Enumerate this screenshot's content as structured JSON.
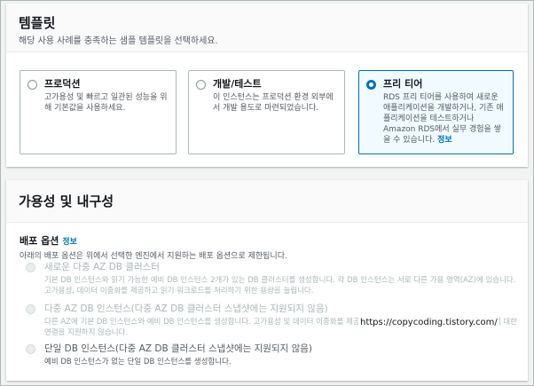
{
  "templates": {
    "title": "템플릿",
    "description": "해당 사용 사례를 충족하는 샘플 템플릿을 선택하세요.",
    "options": [
      {
        "title": "프로덕션",
        "text": "고가용성 및 빠르고 일관된 성능을 위해 기본값을 사용하세요.",
        "selected": false
      },
      {
        "title": "개발/테스트",
        "text": "이 인스턴스는 프로덕션 환경 외부에서 개발 용도로 마련되었습니다.",
        "selected": false
      },
      {
        "title": "프리 티어",
        "text": "RDS 프리 티어를 사용하여 새로운 애플리케이션을 개발하거나, 기존 애플리케이션을 테스트하거나 Amazon RDS에서 실무 경험을 쌓을 수 있습니다.",
        "link": "정보",
        "selected": true
      }
    ]
  },
  "availability": {
    "title": "가용성 및 내구성",
    "deploy_label": "배포 옵션",
    "deploy_info": "정보",
    "deploy_desc": "아래의 배포 옵션은 위에서 선택한 엔진에서 지원하는 배포 옵션으로 제한됩니다.",
    "options": [
      {
        "title": "새로운 다중 AZ DB 클러스터",
        "text": "기본 DB 인스턴스와 읽기 가능한 예비 DB 인스턴스 2개가 있는 DB 클러스터를 생성합니다. 각 DB 인스턴스는 서로 다른 가용 영역(AZ)에 있습니다. 고가용성, 데이터 이중화를 제공하고 읽기 워크로드를 처리하기 위한 용량을 늘립니다.",
        "enabled": false
      },
      {
        "title": "다중 AZ DB 인스턴스(다중 AZ DB 클러스터 스냅샷에는 지원되지 않음)",
        "text": "다른 AZ에 기본 DB 인스턴스와 예비 DB 인스턴스를 생성합니다. 고가용성 및 데이터 이중화를 제공하지만 예비 DB 인스턴스는 읽기 워크로드에 대한 연결을 지원하지 않습니다.",
        "enabled": false
      },
      {
        "title": "단일 DB 인스턴스(다중 AZ DB 클러스터 스냅샷에는 지원되지 않음)",
        "text": "예비 DB 인스턴스가 없는 단일 DB 인스턴스를 생성합니다.",
        "enabled": true
      }
    ]
  },
  "watermark": "https://copycoding.tistory.com/"
}
